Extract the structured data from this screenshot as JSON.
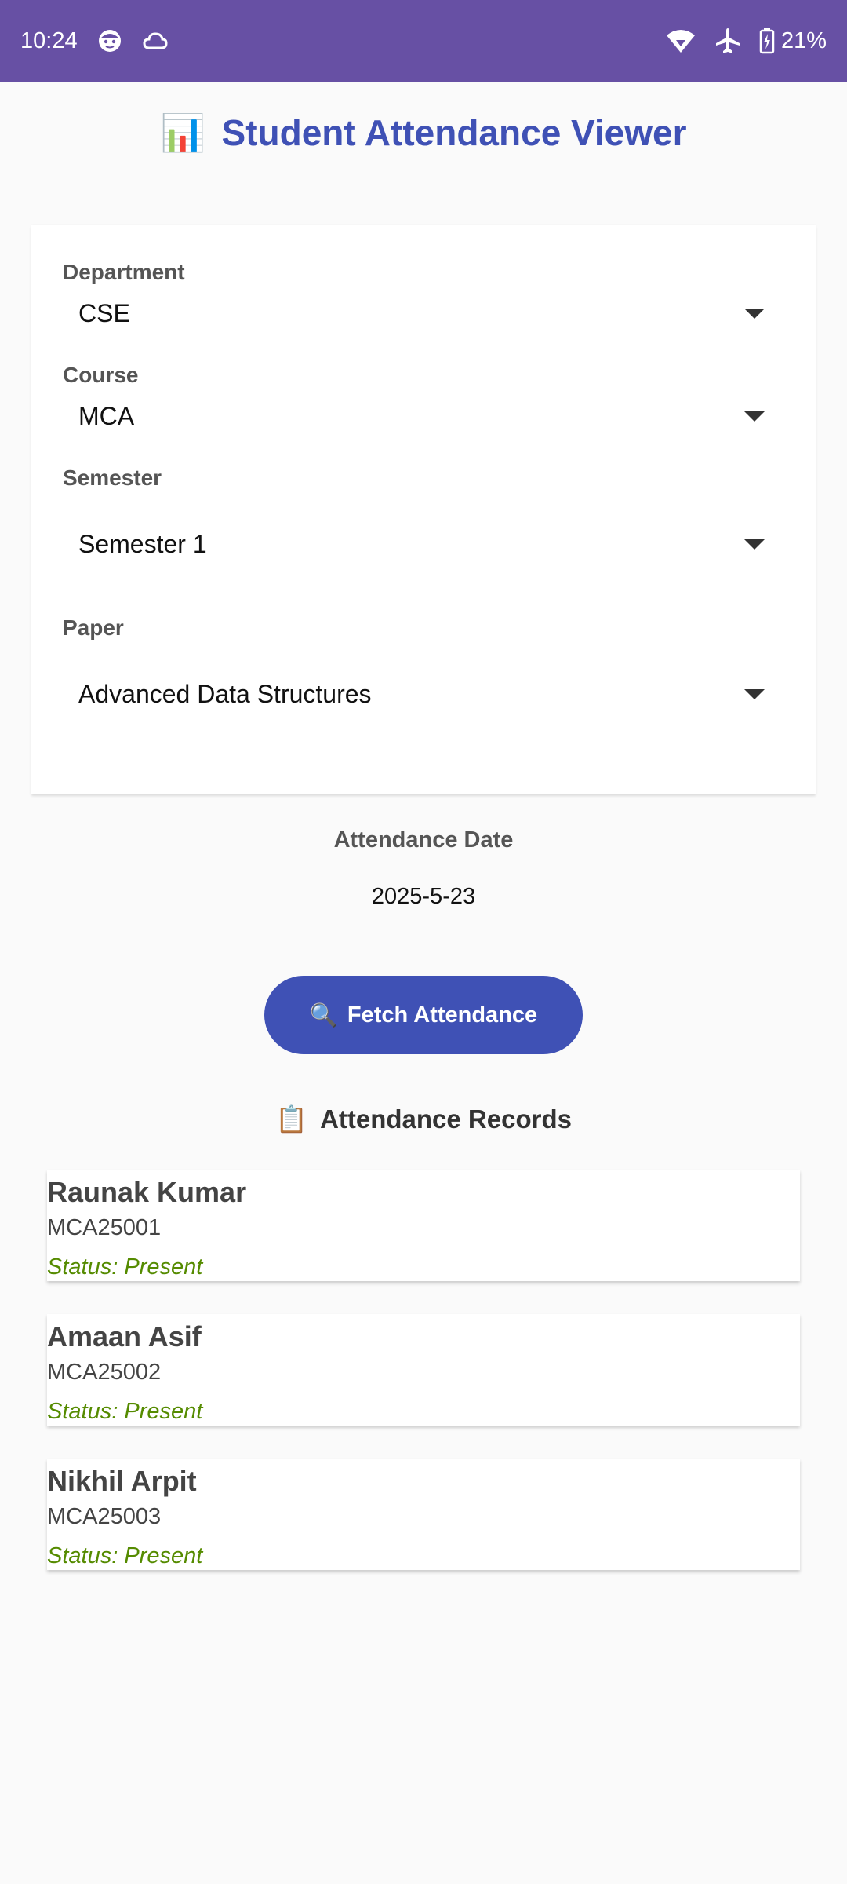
{
  "status_bar": {
    "time": "10:24",
    "battery": "21%",
    "icons": [
      "face-icon",
      "cloud-icon",
      "wifi-icon",
      "airplane-icon",
      "battery-charging-icon"
    ]
  },
  "header": {
    "emoji": "📊",
    "title": "Student Attendance Viewer",
    "color": "#3f51b5"
  },
  "filters": {
    "department": {
      "label": "Department",
      "value": "CSE"
    },
    "course": {
      "label": "Course",
      "value": "MCA"
    },
    "semester": {
      "label": "Semester",
      "value": "Semester 1"
    },
    "paper": {
      "label": "Paper",
      "value": "Advanced Data Structures"
    }
  },
  "date": {
    "label": "Attendance Date",
    "value": "2025-5-23"
  },
  "fetch_button": {
    "emoji": "🔍",
    "label": "Fetch Attendance"
  },
  "records": {
    "emoji": "📋",
    "title": "Attendance Records",
    "items": [
      {
        "name": "Raunak Kumar",
        "id": "MCA25001",
        "status": "Status: Present"
      },
      {
        "name": "Amaan Asif",
        "id": "MCA25002",
        "status": "Status: Present"
      },
      {
        "name": "Nikhil Arpit",
        "id": "MCA25003",
        "status": "Status: Present"
      }
    ]
  },
  "colors": {
    "status_bar": "#6750a4",
    "accent": "#3f51b5",
    "present": "#558b00"
  }
}
